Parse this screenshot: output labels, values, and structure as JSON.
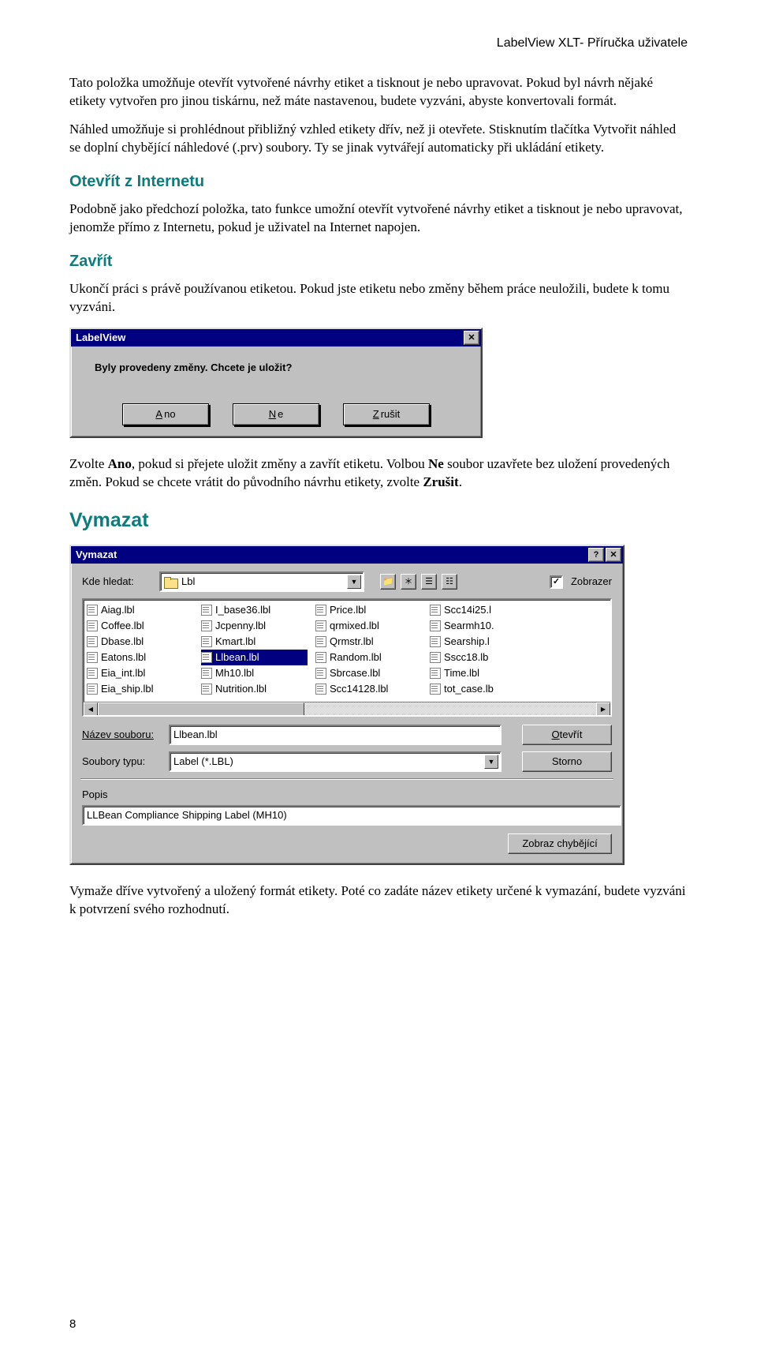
{
  "header": "LabelView XLT- Příručka uživatele",
  "para1": "Tato položka umožňuje otevřít vytvořené návrhy etiket a tisknout je nebo upravovat. Pokud byl návrh nějaké etikety vytvořen pro jinou tiskárnu, než máte nastavenou, budete vyzváni, abyste konvertovali formát.",
  "para2": "Náhled umožňuje si prohlédnout přibližný vzhled etikety dřív, než ji otevřete. Stisknutím tlačítka Vytvořit náhled se doplní chybějící náhledové (.prv) soubory. Ty se jinak vytvářejí automaticky při ukládání etikety.",
  "h_internet": "Otevřít z Internetu",
  "para3": "Podobně jako předchozí položka, tato funkce umožní otevřít vytvořené návrhy etiket a tisknout je nebo upravovat, jenomže přímo z Internetu, pokud je uživatel na Internet napojen.",
  "h_zavrit": "Zavřít",
  "para4": "Ukončí práci s právě používanou etiketou. Pokud jste etiketu nebo změny během práce neuložili, budete k tomu vyzváni.",
  "dlg1": {
    "title": "LabelView",
    "msg": "Byly provedeny změny.  Chcete je uložit?",
    "ano_u": "A",
    "ano_r": "no",
    "ne_u": "N",
    "ne_r": "e",
    "zr_u": "Z",
    "zr_r": "rušit"
  },
  "para5a": "Zvolte ",
  "para5b": "Ano",
  "para5c": ", pokud si přejete uložit změny a zavřít etiketu. Volbou ",
  "para5d": "Ne",
  "para5e": " soubor uzavřete bez uložení provedených změn. Pokud se chcete vrátit do původního návrhu etikety, zvolte ",
  "para5f": "Zrušit",
  "para5g": ".",
  "h_vymazat": "Vymazat",
  "dlg2": {
    "title": "Vymazat",
    "kde": "Kde hledat:",
    "folder": "Lbl",
    "zobrazer": "Zobrazer",
    "files": [
      [
        "Aiag.lbl",
        "Coffee.lbl",
        "Dbase.lbl",
        "Eatons.lbl",
        "Eia_int.lbl",
        "Eia_ship.lbl"
      ],
      [
        "I_base36.lbl",
        "Jcpenny.lbl",
        "Kmart.lbl",
        "Llbean.lbl",
        "Mh10.lbl",
        "Nutrition.lbl"
      ],
      [
        "Price.lbl",
        "qrmixed.lbl",
        "Qrmstr.lbl",
        "Random.lbl",
        "Sbrcase.lbl",
        "Scc14128.lbl"
      ],
      [
        "Scc14i25.l",
        "Searmh10.",
        "Searship.l",
        "Sscc18.lb",
        "Time.lbl",
        "tot_case.lb"
      ]
    ],
    "sel_row": 3,
    "sel_col": 1,
    "nazev_l": "Název souboru:",
    "nazev_v": "Llbean.lbl",
    "typ_l": "Soubory typu:",
    "typ_v": "Label (*.LBL)",
    "otev_u": "O",
    "otev_r": "tevřít",
    "storno": "Storno",
    "popis_l": "Popis",
    "popis_v": "LLBean Compliance Shipping Label (MH10)",
    "zobrazch": "Zobraz chybějící"
  },
  "para6": "Vymaže dříve vytvořený a uložený formát etikety. Poté co zadáte název etikety určené k vymazání, budete vyzváni k potvrzení svého rozhodnutí.",
  "pagenum": "8"
}
